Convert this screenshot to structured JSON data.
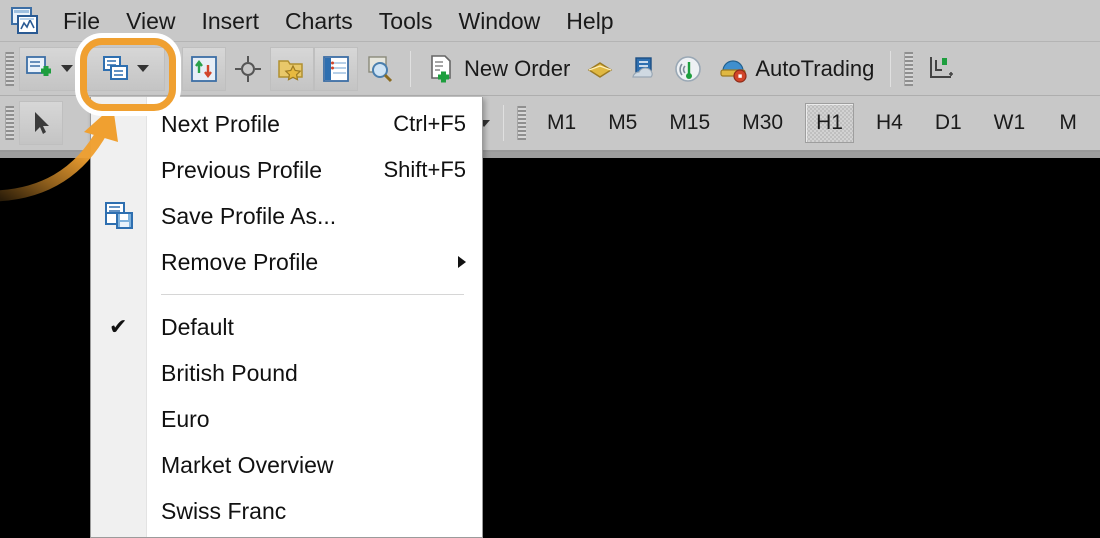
{
  "app": {
    "title_icon": "metatrader-app-icon"
  },
  "menubar": {
    "items": [
      {
        "label": "File",
        "name": "menubar-item-file"
      },
      {
        "label": "View",
        "name": "menubar-item-view"
      },
      {
        "label": "Insert",
        "name": "menubar-item-insert"
      },
      {
        "label": "Charts",
        "name": "menubar-item-charts"
      },
      {
        "label": "Tools",
        "name": "menubar-item-tools"
      },
      {
        "label": "Window",
        "name": "menubar-item-window"
      },
      {
        "label": "Help",
        "name": "menubar-item-help"
      }
    ]
  },
  "toolbar_main": {
    "new_chart": {
      "icon": "new-chart-icon"
    },
    "profiles": {
      "icon": "profiles-icon"
    },
    "indicators": {
      "icon": "indicators-icon"
    },
    "crosshair": {
      "icon": "crosshair-icon"
    },
    "templates": {
      "icon": "templates-icon"
    },
    "data_window": {
      "icon": "data-window-icon"
    },
    "zoom_tool": {
      "icon": "zoom-icon"
    },
    "new_order_label": "New Order",
    "new_order_icon": "new-order-icon",
    "strategy_tester_icon": "strategy-tester-icon",
    "market_icon": "market-icon",
    "signals_icon": "signals-icon",
    "autotrading_label": "AutoTrading",
    "autotrading_icon": "autotrading-icon",
    "chart_shift_icon": "chart-shift-icon"
  },
  "toolbar_chart": {
    "cursor_icon": "cursor-icon",
    "crosshair_cursor_icon": "crosshair-cursor-icon",
    "text_label_icon": "text-label-icon",
    "objects_icon": "objects-icon",
    "timeframes": [
      {
        "label": "M1",
        "active": false
      },
      {
        "label": "M5",
        "active": false
      },
      {
        "label": "M15",
        "active": false
      },
      {
        "label": "M30",
        "active": false
      },
      {
        "label": "H1",
        "active": true
      },
      {
        "label": "H4",
        "active": false
      },
      {
        "label": "D1",
        "active": false
      },
      {
        "label": "W1",
        "active": false
      },
      {
        "label": "M",
        "active": false
      }
    ]
  },
  "profiles_menu": {
    "commands": [
      {
        "label": "Next Profile",
        "accel": "Ctrl+F5",
        "icon": null,
        "submenu": false,
        "checked": false,
        "name": "menu-item-next-profile"
      },
      {
        "label": "Previous Profile",
        "accel": "Shift+F5",
        "icon": null,
        "submenu": false,
        "checked": false,
        "name": "menu-item-previous-profile"
      },
      {
        "label": "Save Profile As...",
        "accel": "",
        "icon": "save-profile-icon",
        "submenu": false,
        "checked": false,
        "name": "menu-item-save-profile-as"
      },
      {
        "label": "Remove Profile",
        "accel": "",
        "icon": null,
        "submenu": true,
        "checked": false,
        "name": "menu-item-remove-profile"
      }
    ],
    "profiles": [
      {
        "label": "Default",
        "checked": true,
        "name": "menu-item-profile-default"
      },
      {
        "label": "British Pound",
        "checked": false,
        "name": "menu-item-profile-british-pound"
      },
      {
        "label": "Euro",
        "checked": false,
        "name": "menu-item-profile-euro"
      },
      {
        "label": "Market Overview",
        "checked": false,
        "name": "menu-item-profile-market-overview"
      },
      {
        "label": "Swiss Franc",
        "checked": false,
        "name": "menu-item-profile-swiss-franc"
      }
    ],
    "check_glyph": "✔"
  },
  "annotations": {
    "highlight_color": "#f0a030",
    "highlight_target": "profiles-toolbar-button",
    "arrow_color": "#f0a030",
    "arrow_points_to": "profiles-toolbar-button"
  }
}
